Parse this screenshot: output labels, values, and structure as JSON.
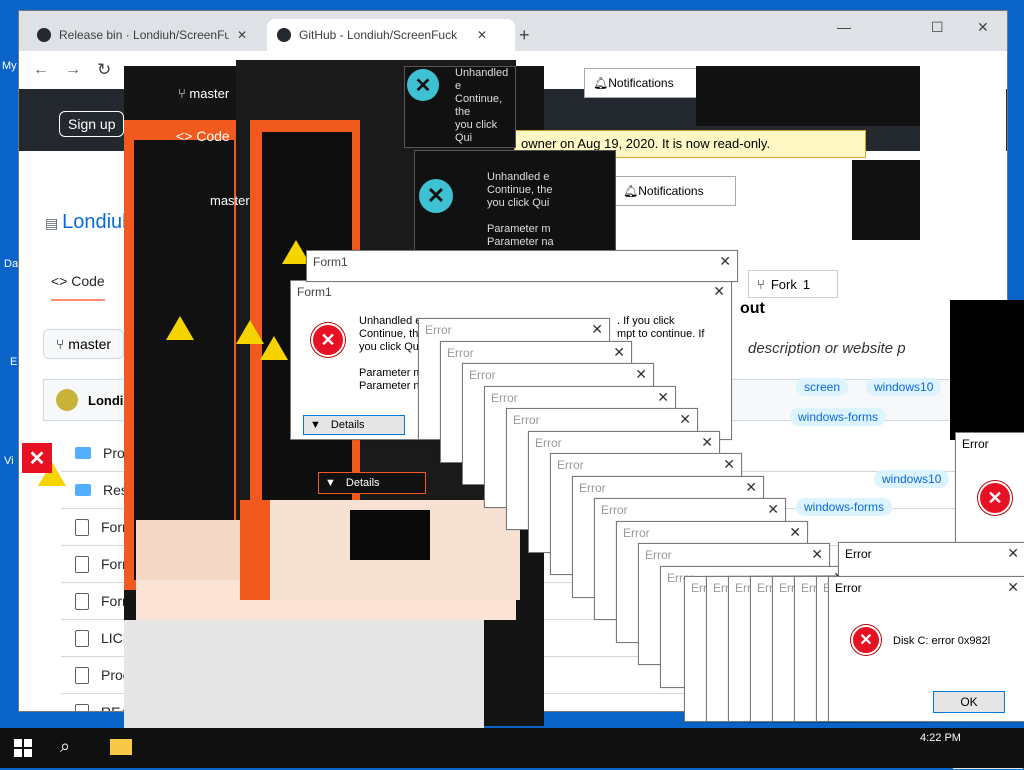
{
  "desktop": {
    "labels": [
      "My",
      "Da",
      "E",
      "Vi"
    ]
  },
  "browser": {
    "tabs": [
      {
        "label": "Release bin · Londiuh/ScreenFuck",
        "close": "✕"
      },
      {
        "label": "GitHub - Londiuh/ScreenFuck",
        "close": "✕"
      }
    ],
    "new_tab": "+",
    "window_controls": {
      "minimize": "—",
      "maximize": "☐",
      "close": "✕"
    },
    "toolbar": {
      "back": "←",
      "forward": "→",
      "reload": "↻"
    }
  },
  "github": {
    "sign_up": "Sign up",
    "repo_owner": "Londiuh",
    "code_tab": "Code",
    "branch": "master",
    "user": "Londiu",
    "files": [
      {
        "name": "Properties",
        "type": "folder"
      },
      {
        "name": "Resources",
        "type": "folder"
      },
      {
        "name": "Form",
        "type": "file"
      },
      {
        "name": "Form",
        "type": "file"
      },
      {
        "name": "Form",
        "type": "file"
      },
      {
        "name": "LICEN",
        "type": "file"
      },
      {
        "name": "Progr",
        "type": "file"
      },
      {
        "name": "READ",
        "type": "file"
      }
    ],
    "archived_banner": "owner on Aug 19, 2020. It is now read-only.",
    "fork": "Fork",
    "fork_count": "1",
    "about": "out",
    "about_desc": "description or website p",
    "topics": [
      "screen",
      "windows10",
      "windows-forms",
      "windows10"
    ],
    "notifications": "Notifications"
  },
  "form1": {
    "title": "Form1",
    "message_lines": [
      "Unhandled e",
      "Continue, the",
      "you click Qui",
      "",
      "Parameter m",
      "Parameter na"
    ],
    "message_right": [
      ". If you click",
      "mpt to continue. If"
    ],
    "details": "Details"
  },
  "error_stack": {
    "title": "Error"
  },
  "final_error": {
    "title": "Error",
    "message": "Disk C: error 0x982l",
    "ok": "OK"
  },
  "bottom_ok": "OK",
  "taskbar": {
    "time": "4:22 PM"
  },
  "colors": {
    "desktop_blue": "#0a64c8",
    "error_red": "#e81123",
    "github_dark": "#24292f",
    "glitch_orange": "#f05a1e",
    "archived_yellow": "#fff8c5"
  }
}
